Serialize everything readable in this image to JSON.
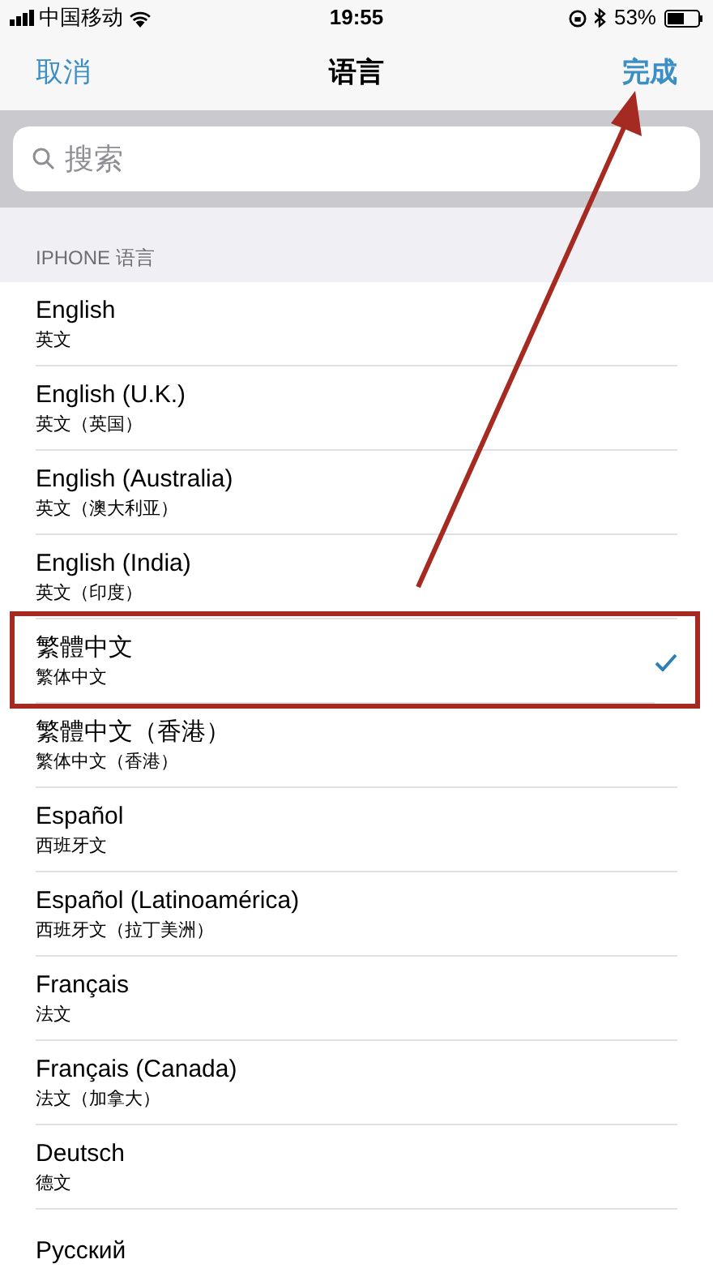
{
  "status_bar": {
    "carrier": "中国移动",
    "time": "19:55",
    "battery": "53%"
  },
  "nav": {
    "cancel": "取消",
    "title": "语言",
    "done": "完成"
  },
  "search": {
    "placeholder": "搜索"
  },
  "section": {
    "header": "IPHONE 语言"
  },
  "languages": [
    {
      "name": "English",
      "native": "英文",
      "selected": false
    },
    {
      "name": "English (U.K.)",
      "native": "英文（英国）",
      "selected": false
    },
    {
      "name": "English (Australia)",
      "native": "英文（澳大利亚）",
      "selected": false
    },
    {
      "name": "English (India)",
      "native": "英文（印度）",
      "selected": false
    },
    {
      "name": "繁體中文",
      "native": "繁体中文",
      "selected": true
    },
    {
      "name": "繁體中文（香港）",
      "native": "繁体中文（香港）",
      "selected": false
    },
    {
      "name": "Español",
      "native": "西班牙文",
      "selected": false
    },
    {
      "name": "Español (Latinoamérica)",
      "native": "西班牙文（拉丁美洲）",
      "selected": false
    },
    {
      "name": "Français",
      "native": "法文",
      "selected": false
    },
    {
      "name": "Français (Canada)",
      "native": "法文（加拿大）",
      "selected": false
    },
    {
      "name": "Deutsch",
      "native": "德文",
      "selected": false
    },
    {
      "name": "Русский",
      "selected": false
    }
  ]
}
